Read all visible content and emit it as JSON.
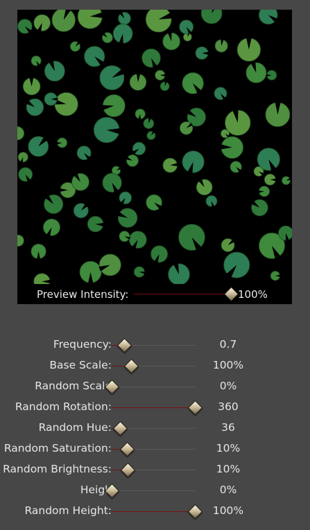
{
  "preview": {
    "intensity_label": "Preview Intensity:",
    "intensity_value": "100%",
    "intensity_fraction": 1.0
  },
  "sliders": [
    {
      "id": "frequency",
      "label": "Frequency:",
      "value": "0.7",
      "fraction": 0.15
    },
    {
      "id": "base-scale",
      "label": "Base Scale:",
      "value": "100%",
      "fraction": 0.23
    },
    {
      "id": "random-scale",
      "label": "Random Scale",
      "value": "0%",
      "fraction": 0.0
    },
    {
      "id": "random-rotation",
      "label": "Random Rotation:",
      "value": "360",
      "fraction": 1.0
    },
    {
      "id": "random-hue",
      "label": "Random Hue:",
      "value": "36",
      "fraction": 0.1
    },
    {
      "id": "random-saturation",
      "label": "Random Saturation:",
      "value": "10%",
      "fraction": 0.18
    },
    {
      "id": "random-brightness",
      "label": "Random Brightness:",
      "value": "10%",
      "fraction": 0.19
    },
    {
      "id": "height",
      "label": "Heigh",
      "value": "0%",
      "fraction": 0.0
    },
    {
      "id": "random-height",
      "label": "Random Height:",
      "value": "100%",
      "fraction": 1.0
    }
  ],
  "colors": {
    "background": "#474747",
    "track": "#5c5c5c",
    "track_fill": "#7a1212",
    "leaf_greens": [
      "#2f7a3a",
      "#3f8a3c",
      "#4f8f3f",
      "#2d7d55",
      "#5a9640"
    ]
  }
}
